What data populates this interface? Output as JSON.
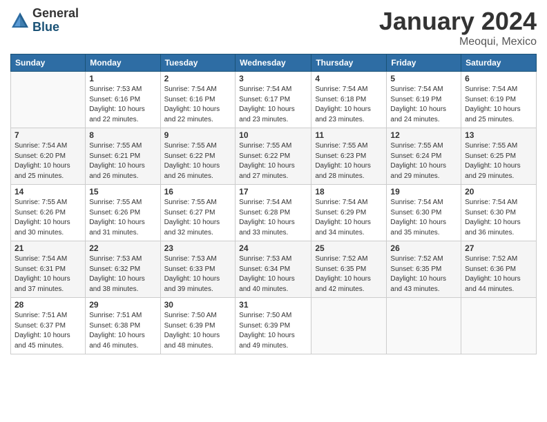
{
  "header": {
    "logo_general": "General",
    "logo_blue": "Blue",
    "month_title": "January 2024",
    "location": "Meoqui, Mexico"
  },
  "days_of_week": [
    "Sunday",
    "Monday",
    "Tuesday",
    "Wednesday",
    "Thursday",
    "Friday",
    "Saturday"
  ],
  "weeks": [
    [
      {
        "day": "",
        "info": ""
      },
      {
        "day": "1",
        "info": "Sunrise: 7:53 AM\nSunset: 6:16 PM\nDaylight: 10 hours\nand 22 minutes."
      },
      {
        "day": "2",
        "info": "Sunrise: 7:54 AM\nSunset: 6:16 PM\nDaylight: 10 hours\nand 22 minutes."
      },
      {
        "day": "3",
        "info": "Sunrise: 7:54 AM\nSunset: 6:17 PM\nDaylight: 10 hours\nand 23 minutes."
      },
      {
        "day": "4",
        "info": "Sunrise: 7:54 AM\nSunset: 6:18 PM\nDaylight: 10 hours\nand 23 minutes."
      },
      {
        "day": "5",
        "info": "Sunrise: 7:54 AM\nSunset: 6:19 PM\nDaylight: 10 hours\nand 24 minutes."
      },
      {
        "day": "6",
        "info": "Sunrise: 7:54 AM\nSunset: 6:19 PM\nDaylight: 10 hours\nand 25 minutes."
      }
    ],
    [
      {
        "day": "7",
        "info": "Sunrise: 7:54 AM\nSunset: 6:20 PM\nDaylight: 10 hours\nand 25 minutes."
      },
      {
        "day": "8",
        "info": "Sunrise: 7:55 AM\nSunset: 6:21 PM\nDaylight: 10 hours\nand 26 minutes."
      },
      {
        "day": "9",
        "info": "Sunrise: 7:55 AM\nSunset: 6:22 PM\nDaylight: 10 hours\nand 26 minutes."
      },
      {
        "day": "10",
        "info": "Sunrise: 7:55 AM\nSunset: 6:22 PM\nDaylight: 10 hours\nand 27 minutes."
      },
      {
        "day": "11",
        "info": "Sunrise: 7:55 AM\nSunset: 6:23 PM\nDaylight: 10 hours\nand 28 minutes."
      },
      {
        "day": "12",
        "info": "Sunrise: 7:55 AM\nSunset: 6:24 PM\nDaylight: 10 hours\nand 29 minutes."
      },
      {
        "day": "13",
        "info": "Sunrise: 7:55 AM\nSunset: 6:25 PM\nDaylight: 10 hours\nand 29 minutes."
      }
    ],
    [
      {
        "day": "14",
        "info": "Sunrise: 7:55 AM\nSunset: 6:26 PM\nDaylight: 10 hours\nand 30 minutes."
      },
      {
        "day": "15",
        "info": "Sunrise: 7:55 AM\nSunset: 6:26 PM\nDaylight: 10 hours\nand 31 minutes."
      },
      {
        "day": "16",
        "info": "Sunrise: 7:55 AM\nSunset: 6:27 PM\nDaylight: 10 hours\nand 32 minutes."
      },
      {
        "day": "17",
        "info": "Sunrise: 7:54 AM\nSunset: 6:28 PM\nDaylight: 10 hours\nand 33 minutes."
      },
      {
        "day": "18",
        "info": "Sunrise: 7:54 AM\nSunset: 6:29 PM\nDaylight: 10 hours\nand 34 minutes."
      },
      {
        "day": "19",
        "info": "Sunrise: 7:54 AM\nSunset: 6:30 PM\nDaylight: 10 hours\nand 35 minutes."
      },
      {
        "day": "20",
        "info": "Sunrise: 7:54 AM\nSunset: 6:30 PM\nDaylight: 10 hours\nand 36 minutes."
      }
    ],
    [
      {
        "day": "21",
        "info": "Sunrise: 7:54 AM\nSunset: 6:31 PM\nDaylight: 10 hours\nand 37 minutes."
      },
      {
        "day": "22",
        "info": "Sunrise: 7:53 AM\nSunset: 6:32 PM\nDaylight: 10 hours\nand 38 minutes."
      },
      {
        "day": "23",
        "info": "Sunrise: 7:53 AM\nSunset: 6:33 PM\nDaylight: 10 hours\nand 39 minutes."
      },
      {
        "day": "24",
        "info": "Sunrise: 7:53 AM\nSunset: 6:34 PM\nDaylight: 10 hours\nand 40 minutes."
      },
      {
        "day": "25",
        "info": "Sunrise: 7:52 AM\nSunset: 6:35 PM\nDaylight: 10 hours\nand 42 minutes."
      },
      {
        "day": "26",
        "info": "Sunrise: 7:52 AM\nSunset: 6:35 PM\nDaylight: 10 hours\nand 43 minutes."
      },
      {
        "day": "27",
        "info": "Sunrise: 7:52 AM\nSunset: 6:36 PM\nDaylight: 10 hours\nand 44 minutes."
      }
    ],
    [
      {
        "day": "28",
        "info": "Sunrise: 7:51 AM\nSunset: 6:37 PM\nDaylight: 10 hours\nand 45 minutes."
      },
      {
        "day": "29",
        "info": "Sunrise: 7:51 AM\nSunset: 6:38 PM\nDaylight: 10 hours\nand 46 minutes."
      },
      {
        "day": "30",
        "info": "Sunrise: 7:50 AM\nSunset: 6:39 PM\nDaylight: 10 hours\nand 48 minutes."
      },
      {
        "day": "31",
        "info": "Sunrise: 7:50 AM\nSunset: 6:39 PM\nDaylight: 10 hours\nand 49 minutes."
      },
      {
        "day": "",
        "info": ""
      },
      {
        "day": "",
        "info": ""
      },
      {
        "day": "",
        "info": ""
      }
    ]
  ]
}
